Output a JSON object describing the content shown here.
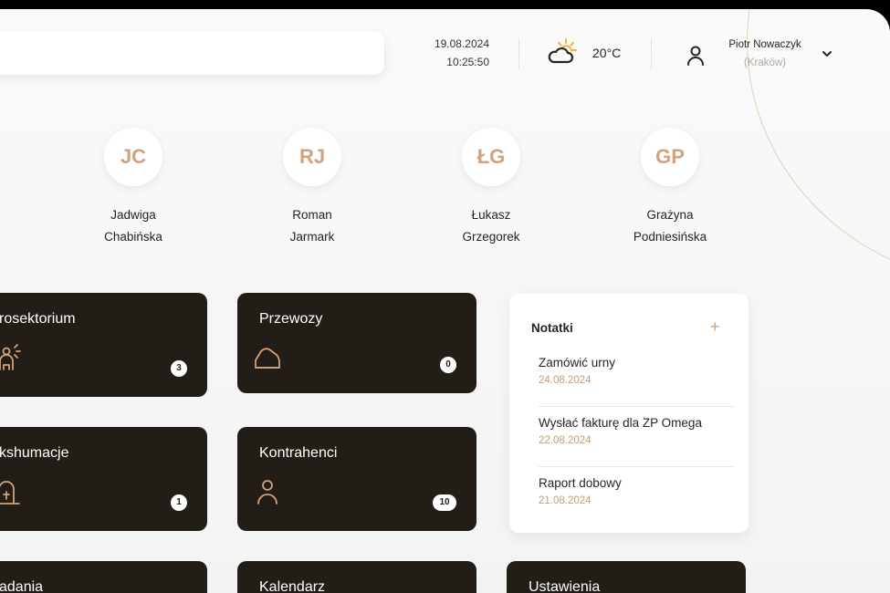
{
  "header": {
    "search_placeholder": "",
    "date": "19.08.2024",
    "time": "10:25:50",
    "temperature": "20°C",
    "user_name": "Piotr Nowaczyk",
    "user_city": "(Kraków)"
  },
  "contacts": [
    {
      "initials": "JC",
      "first": "Jadwiga",
      "last": "Chabińska"
    },
    {
      "initials": "RJ",
      "first": "Roman",
      "last": "Jarmark"
    },
    {
      "initials": "ŁG",
      "first": "Łukasz",
      "last": "Grzegorek"
    },
    {
      "initials": "GP",
      "first": "Grażyna",
      "last": "Podniesińska"
    }
  ],
  "tiles": {
    "prosektorium": {
      "label": "rosektorium",
      "count": "3"
    },
    "przewozy": {
      "label": "Przewozy",
      "count": "0"
    },
    "ekshumacje": {
      "label": "kshumacje",
      "count": "1"
    },
    "kontrahenci": {
      "label": "Kontrahenci",
      "count": "10"
    },
    "zadania": {
      "label": "adania"
    },
    "kalendarz": {
      "label": "Kalendarz"
    },
    "ustawienia": {
      "label": "Ustawienia"
    }
  },
  "notes": {
    "title": "Notatki",
    "add": "+",
    "items": [
      {
        "title": "Zamówić urny",
        "date": "24.08.2024"
      },
      {
        "title": "Wysłać fakturę dla ZP Omega",
        "date": "22.08.2024"
      },
      {
        "title": "Raport dobowy",
        "date": "21.08.2024"
      }
    ]
  },
  "colors": {
    "accent": "#d2a27c",
    "tile_bg": "#231d17",
    "background": "#f7f7f7"
  }
}
